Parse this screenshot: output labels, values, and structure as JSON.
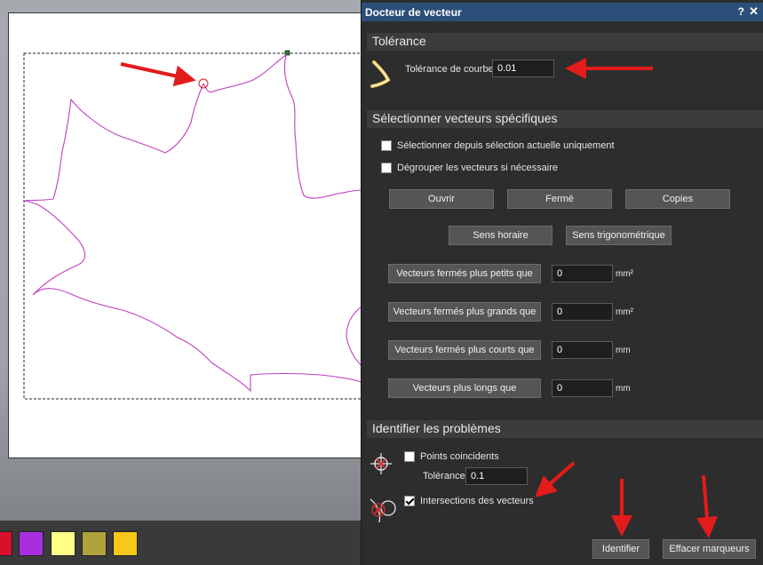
{
  "dialog": {
    "title": "Docteur de vecteur",
    "help": "?",
    "close": "✕"
  },
  "tolerance": {
    "heading": "Tolérance",
    "curve_label": "Tolérance de courbe",
    "curve_value": "0.01"
  },
  "select_specific": {
    "heading": "Sélectionner vecteurs spécifiques",
    "checkbox_current_selection": {
      "label": "Sélectionner depuis sélection actuelle uniquement",
      "checked": false
    },
    "checkbox_ungroup": {
      "label": "Dégrouper les vecteurs si nécessaire",
      "checked": false
    },
    "btn_open": "Ouvrir",
    "btn_closed": "Fermé",
    "btn_copies": "Copies",
    "btn_clockwise": "Sens horaire",
    "btn_counterclockwise": "Sens trigonométrique",
    "filters": [
      {
        "button": "Vecteurs fermés plus petits que",
        "value": "0",
        "unit": "mm²"
      },
      {
        "button": "Vecteurs fermés plus grands que",
        "value": "0",
        "unit": "mm²"
      },
      {
        "button": "Vecteurs fermés plus courts que",
        "value": "0",
        "unit": "mm"
      },
      {
        "button": "Vecteurs plus longs que",
        "value": "0",
        "unit": "mm"
      }
    ]
  },
  "problems": {
    "heading": "Identifier les problèmes",
    "coincident": {
      "label": "Points coincidents",
      "checked": false
    },
    "tolerance_label": "Tolérance",
    "tolerance_value": "0.1",
    "intersections": {
      "label": "Intersections des vecteurs",
      "checked": true
    },
    "btn_identify": "Identifier",
    "btn_clear_markers": "Effacer marqueurs"
  },
  "palette": {
    "colors": [
      "#d8102c",
      "#a82ee0",
      "#ffff88",
      "#b0a23c",
      "#f8c818"
    ]
  },
  "colors": {
    "accent_titlebar": "#2b4f78",
    "vector_path": "#c040c0",
    "annotation_arrow": "#e21b1b"
  }
}
